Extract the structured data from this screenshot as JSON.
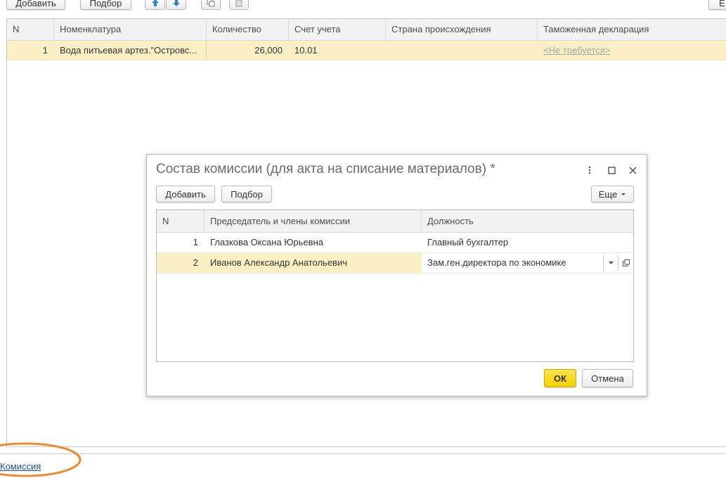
{
  "toolbar": {
    "add_label": "Добавить",
    "pick_label": "Подбор",
    "right_cut_label": "Е"
  },
  "main_table": {
    "columns": [
      "N",
      "Номенклатура",
      "Количество",
      "Счет учета",
      "Страна происхождения",
      "Таможенная декларация"
    ],
    "rows": [
      {
        "n": "1",
        "item": "Вода питьевая артез.\"Островс...",
        "qty": "26,000",
        "account": "10.01",
        "country": "",
        "declaration": "<Не требуется>"
      }
    ]
  },
  "dialog": {
    "title": "Состав комиссии (для акта на списание материалов) *",
    "add_label": "Добавить",
    "pick_label": "Подбор",
    "more_label": "Еще",
    "columns": [
      "N",
      "Председатель и члены комиссии",
      "Должность"
    ],
    "rows": [
      {
        "n": "1",
        "name": "Глазкова Оксана Юрьевна",
        "position": "Главный бухгалтер"
      },
      {
        "n": "2",
        "name": "Иванов Александр Анатольевич",
        "position": "Зам.ген.директора по экономике"
      }
    ],
    "ok_label": "ОК",
    "cancel_label": "Отмена"
  },
  "footer": {
    "link_label": "Комиссия"
  },
  "colors": {
    "selected_row": "#fbf0c4",
    "ok_button": "#f4cf00",
    "highlight_ellipse": "#f0892f",
    "link": "#1a4f8f"
  }
}
